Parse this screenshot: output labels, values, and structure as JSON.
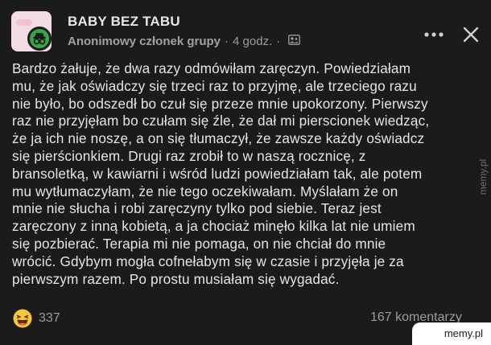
{
  "post": {
    "group_name": "BABY BEZ TABU",
    "author": "Anonimowy członek grupy",
    "separator": "·",
    "time": "4 godz.",
    "audience_icon": "members-icon",
    "lines": [
      "Bardzo żałuje, że dwa razy odmówiłam zaręczyn. Powiedziałam",
      "mu, że jak oświadczy się trzeci raz to przyjmę, ale trzeciego razu",
      "nie było, bo odszedł bo czuł się przeze mnie upokorzony. Pierwszy",
      "raz nie przyjęłam bo czułam się źle, że dał mi pierscionek wiedząc,",
      "że ja ich nie noszę, a on się tłumaczył, że zawsze każdy oświadcz",
      "się pierścionkiem. Drugi raz zrobił to w naszą rocznicę, z",
      "bransoletką, w kawiarni i wśród ludzi powiedziałam tak, ale potem",
      "mu wytłumaczyłam, że nie tego oczekiwałam. Myślałam że on",
      "mnie nie słucha i robi zaręczyny tylko pod siebie. Teraz jest",
      "zaręczony z inną kobietą, a ja chociaż minęło kilka lat nie umiem",
      "się pozbierać. Terapia mi nie pomaga, on nie chciał do mnie",
      "wrócić. Gdybym mogła cofnełabym się w czasie i przyjęła je za",
      "pierwszym razem. Po prostu musiałam się wygadać."
    ]
  },
  "footer": {
    "reaction_icon": "haha-emoji-icon",
    "reaction_count": "337",
    "comments": "167 komentarzy"
  },
  "controls": {
    "more_icon": "more-options-icon",
    "close_icon": "close-icon"
  },
  "watermarks": {
    "side": "memy.pl",
    "corner": "memy.pl"
  },
  "colors": {
    "background": "#1b1b1c",
    "text": "#e4e5e8",
    "muted": "#9a9ca2",
    "anon_badge": "#38a54b",
    "haha_yellow": "#f7c53b"
  }
}
